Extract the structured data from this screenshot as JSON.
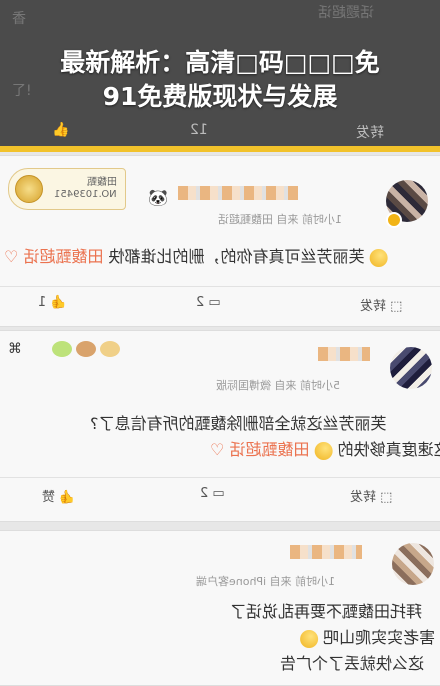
{
  "overlay": {
    "title_line1": "最新解析：高清□码□□□免",
    "title_line2": "91免费版现状与发展",
    "ghost_top_right": "话题超话",
    "ghost_left": "香",
    "ghost_left2": "了!",
    "ghost_like_count": "12",
    "ghost_repost": "转发"
  },
  "posts": [
    {
      "meta": "1小时前  来自 田馥甄超话",
      "content_line1": "♡ 田馥甄超话 芙丽芳丝可真有你的，删的比谁都快",
      "tag": "田馥甄超话",
      "body": "芙丽芳丝可真有你的，删的比谁都快",
      "stamp_line1": "田馥甄",
      "stamp_line2": "NO.1039451",
      "actions": {
        "repost": "转发",
        "comment": "2",
        "like": "1"
      }
    },
    {
      "meta": "5小时前  来自 微博国际版",
      "content_line1": "芙丽芳丝这就全部删除馥甄的所有信息了?",
      "content_line2": "这速度真够快的",
      "tag": "田馥甄超话",
      "actions": {
        "repost": "转发",
        "comment": "2",
        "like": "赞"
      }
    },
    {
      "meta": "1小时前  来自 iPhone客户端",
      "content_line1": "拜托田馥甄不要再乱说话了",
      "content_line2": "害老实实爬山吧",
      "content_line3": "这么快就丢了个广告"
    }
  ],
  "colors": {
    "accent": "#eb7350",
    "overlay_bg": "#4b4b4b",
    "highlight_line": "#f2c22b"
  }
}
